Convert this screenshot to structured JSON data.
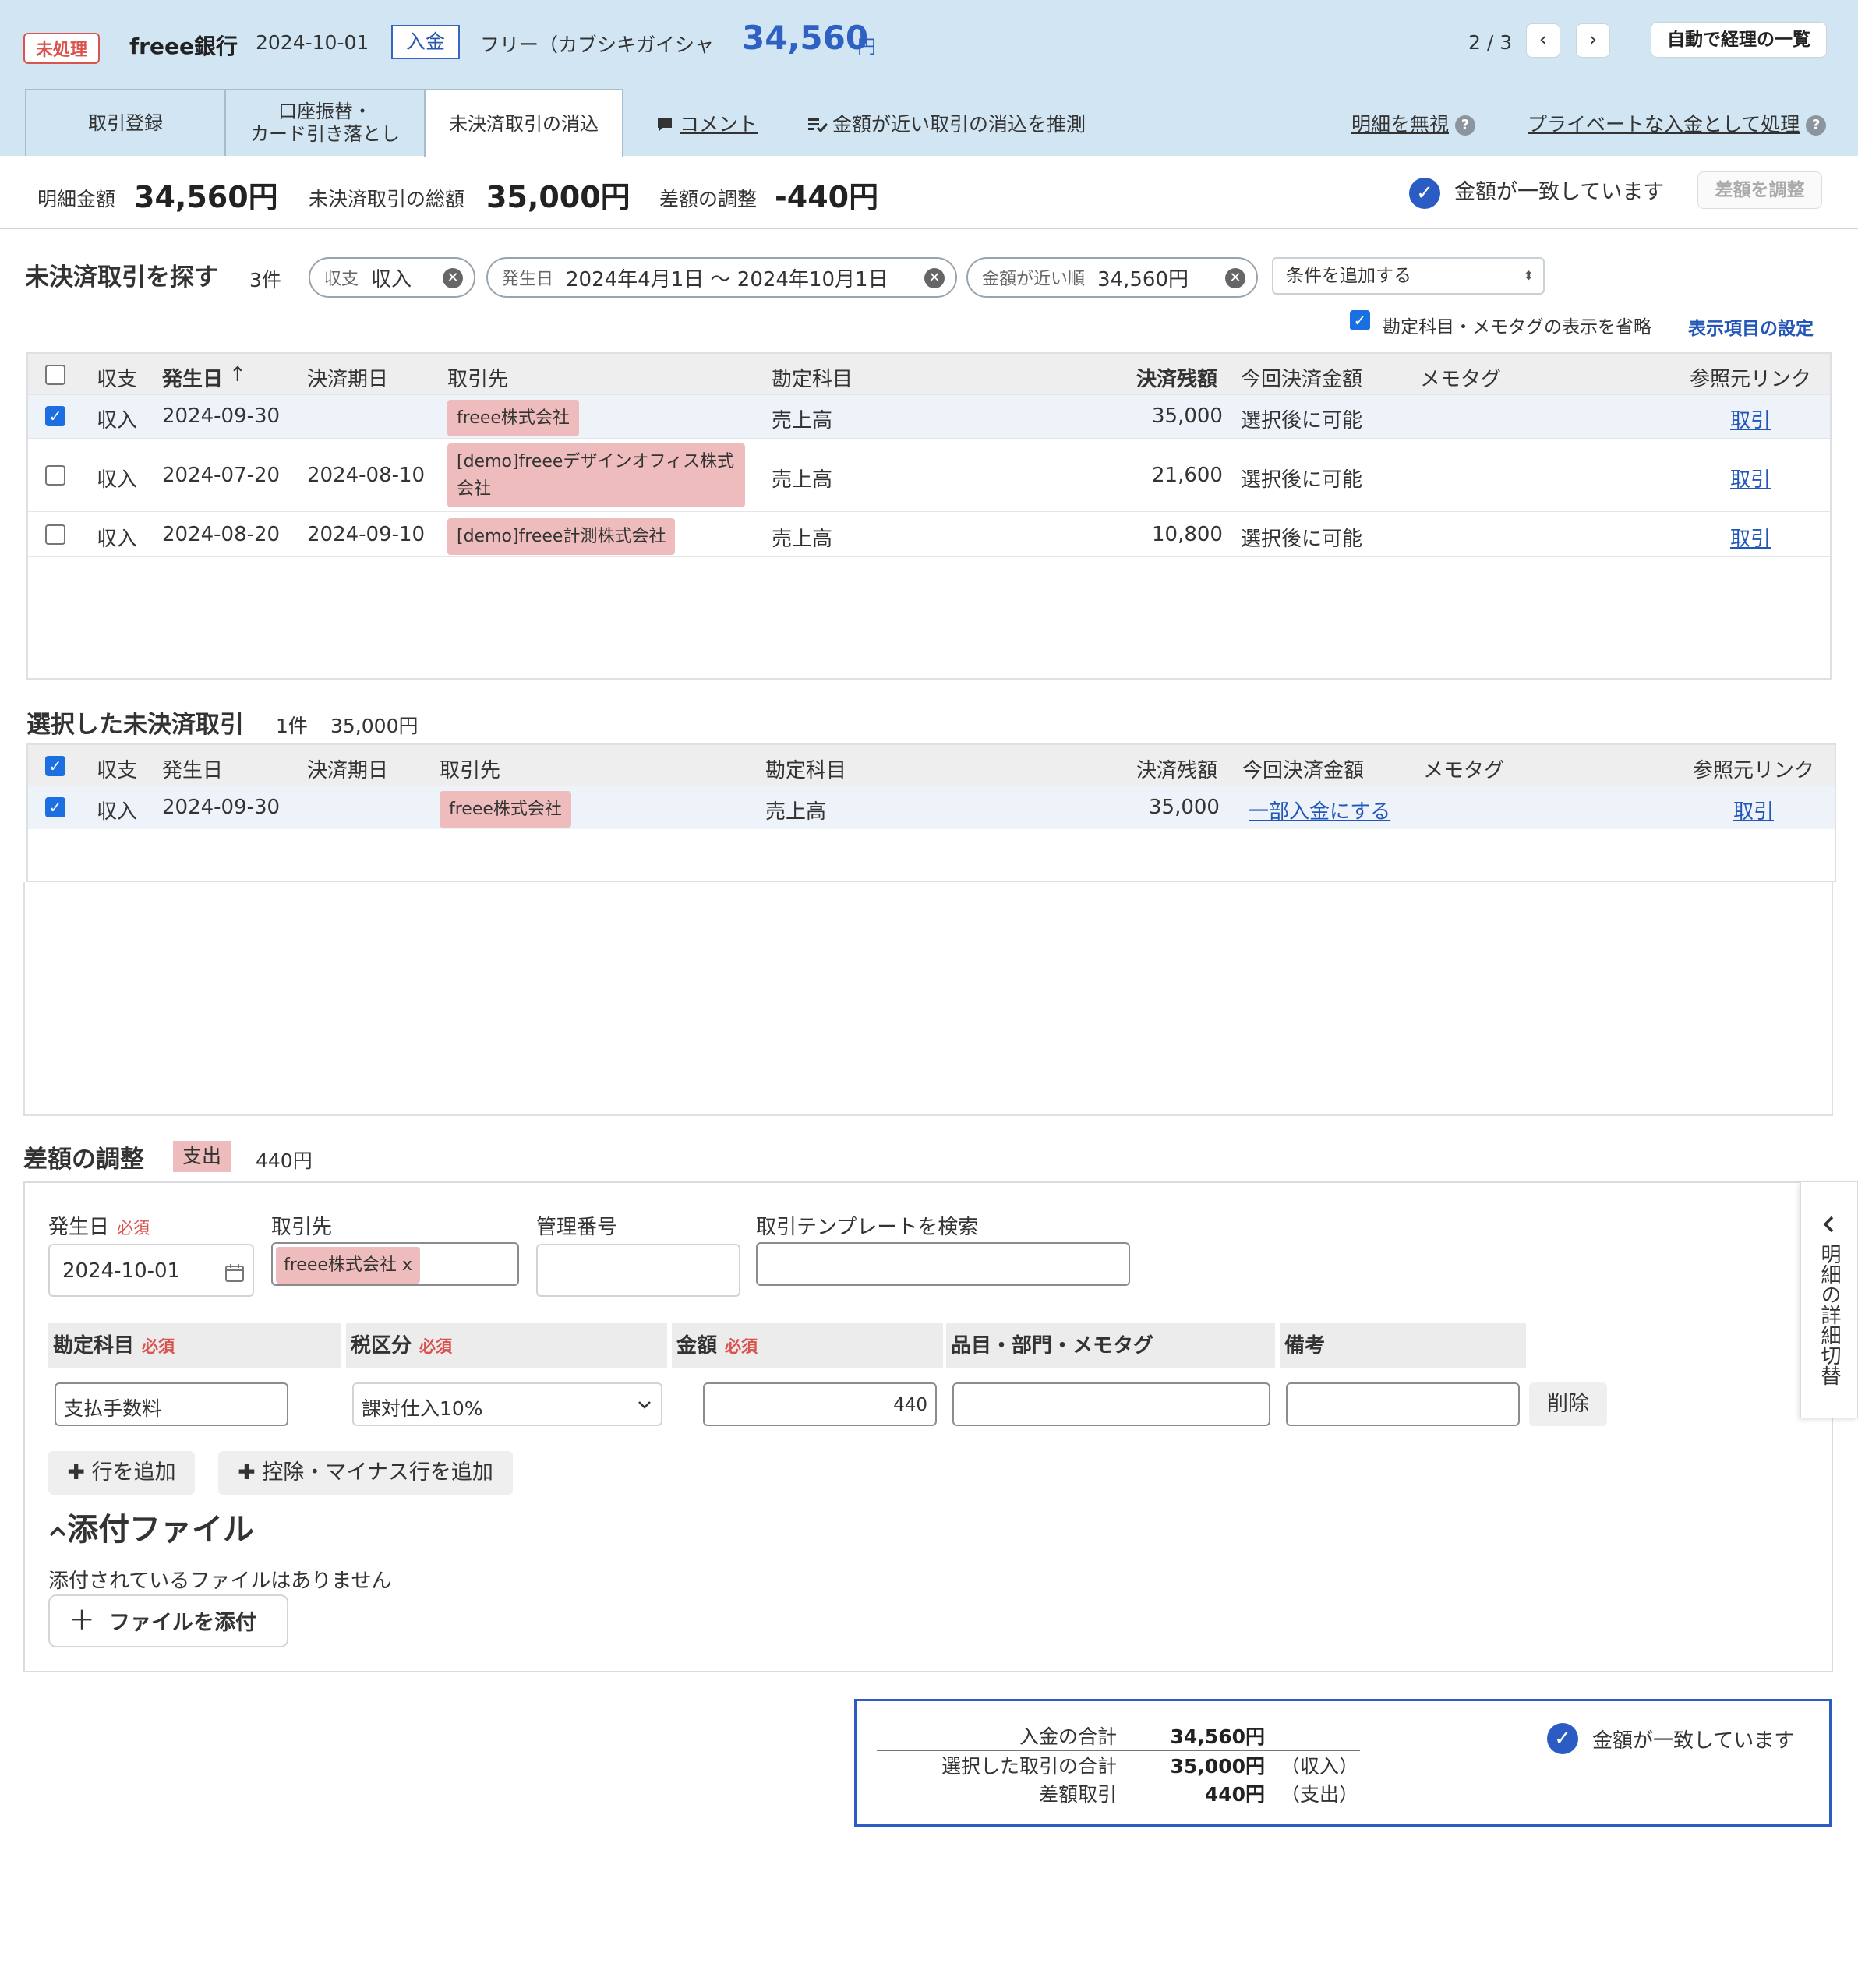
{
  "header": {
    "status_badge": "未処理",
    "bank": "freee銀行",
    "date": "2024-10-01",
    "direction": "入金",
    "payer": "フリー（カブシキガイシャ",
    "amount": "34,560",
    "amount_unit": "円",
    "pager": "2 / 3",
    "prev_icon": "‹",
    "next_icon": "›",
    "list_button": "自動で経理の一覧"
  },
  "tabs": {
    "tab1": "取引登録",
    "tab2_line1": "口座振替・",
    "tab2_line2": "カード引き落とし",
    "tab3": "未決済取引の消込",
    "comment": "コメント",
    "guess": "金額が近い取引の消込を推測",
    "ignore": "明細を無視",
    "private": "プライベートな入金として処理",
    "help": "?"
  },
  "summary": {
    "detail_label": "明細金額",
    "detail_value": "34,560円",
    "open_label": "未決済取引の総額",
    "open_value": "35,000円",
    "diff_label": "差額の調整",
    "diff_value": "-440円",
    "match_text": "金額が一致しています",
    "adjust_button": "差額を調整"
  },
  "search": {
    "title": "未決済取引を探す",
    "count": "3件",
    "filters": [
      {
        "label": "収支",
        "value": "収入"
      },
      {
        "label": "発生日",
        "value": "2024年4月1日 〜 2024年10月1日"
      },
      {
        "label": "金額が近い順",
        "value": "34,560円"
      }
    ],
    "add_condition": "条件を追加する",
    "omit_option": "勘定科目・メモタグの表示を省略",
    "settings_link": "表示項目の設定"
  },
  "columns": {
    "type": "収支",
    "date": "発生日",
    "sort_arrow": "↑",
    "due": "決済期日",
    "partner": "取引先",
    "account": "勘定科目",
    "balance": "決済残額",
    "this_amount": "今回決済金額",
    "memo": "メモタグ",
    "ref": "参照元リンク"
  },
  "search_rows": [
    {
      "type": "収入",
      "date": "2024-09-30",
      "due": "",
      "partner": "freee株式会社",
      "account": "売上高",
      "balance": "35,000",
      "this_amount": "選択後に可能",
      "ref": "取引"
    },
    {
      "type": "収入",
      "date": "2024-07-20",
      "due": "2024-08-10",
      "partner_line1": "[demo]freeeデザインオフィス株式",
      "partner_line2": "会社",
      "account": "売上高",
      "balance": "21,600",
      "this_amount": "選択後に可能",
      "ref": "取引"
    },
    {
      "type": "収入",
      "date": "2024-08-20",
      "due": "2024-09-10",
      "partner": "[demo]freee計測株式会社",
      "account": "売上高",
      "balance": "10,800",
      "this_amount": "選択後に可能",
      "ref": "取引"
    }
  ],
  "selected": {
    "title": "選択した未決済取引",
    "count": "1件",
    "total": "35,000円",
    "row": {
      "type": "収入",
      "date": "2024-09-30",
      "partner": "freee株式会社",
      "account": "売上高",
      "balance": "35,000",
      "this_amount": "一部入金にする",
      "ref": "取引"
    }
  },
  "adjustment": {
    "title": "差額の調整",
    "kind": "支出",
    "amount": "440円",
    "required": "必須",
    "date_label": "発生日",
    "date_value": "2024-10-01",
    "partner_label": "取引先",
    "partner_value": "freee株式会社",
    "partner_remove": "x",
    "mgmt_label": "管理番号",
    "template_label": "取引テンプレートを検索",
    "col_account": "勘定科目",
    "col_tax": "税区分",
    "col_amount": "金額",
    "col_items": "品目・部門・メモタグ",
    "col_note": "備考",
    "account_value": "支払手数料",
    "tax_value": "課対仕入10%",
    "amount_value": "440",
    "delete_button": "削除",
    "add_row": "行を追加",
    "add_minus_row": "控除・マイナス行を追加",
    "attach_title": "添付ファイル",
    "no_files": "添付されているファイルはありません",
    "attach_button": "ファイルを添付",
    "side_tab": "明細の詳細切替"
  },
  "totals": {
    "deposit_label": "入金の合計",
    "deposit_value": "34,560円",
    "selected_label": "選択した取引の合計",
    "selected_value": "35,000円",
    "selected_note": "（収入）",
    "diff_label": "差額取引",
    "diff_value": "440円",
    "diff_note": "（支出）",
    "match_text": "金額が一致しています"
  },
  "colors": {
    "accent_blue": "#2b5cc4",
    "header_bg": "#d2e5f3",
    "tag_pink": "#eebcbc",
    "status_red": "#d9534f"
  },
  "icons": [
    "calendar-icon",
    "check-circle-icon",
    "comment-icon",
    "list-check-icon",
    "help-icon",
    "clear-filter-icon",
    "plus-icon",
    "chevron-up-icon",
    "chevron-left-icon",
    "chevron-down-icon"
  ]
}
